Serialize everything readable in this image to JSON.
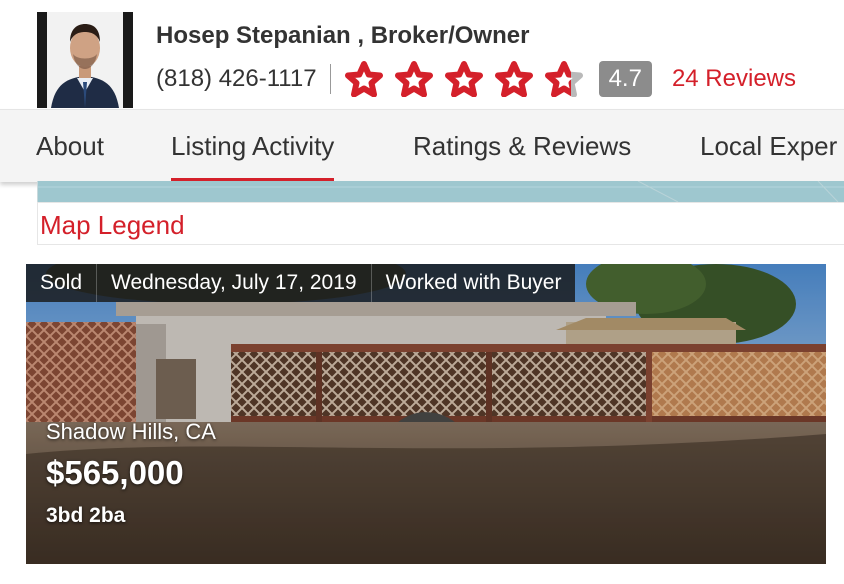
{
  "agent": {
    "name": "Hosep Stepanian , Broker/Owner",
    "phone": "(818) 426-1117",
    "rating": "4.7",
    "rating_value": 4.7,
    "star_count": 5,
    "reviews": "24 Reviews"
  },
  "tabs": [
    {
      "label": "About"
    },
    {
      "label": "Listing Activity",
      "active": true
    },
    {
      "label": "Ratings & Reviews"
    },
    {
      "label": "Local Exper"
    }
  ],
  "map_legend": {
    "title": "Map Legend"
  },
  "listing": {
    "status": "Sold",
    "date": "Wednesday, July 17, 2019",
    "role": "Worked with Buyer",
    "city": "Shadow Hills, CA",
    "price": "$565,000",
    "beds_baths": "3bd 2ba"
  },
  "colors": {
    "accent_red": "#d4202a",
    "badge_gray": "#8c8c8c",
    "tabbar_bg": "#f4f4f4",
    "map_water": "#9ec7cf"
  },
  "icons": [
    "agent-photo",
    "star-icon",
    "star-half-icon"
  ]
}
